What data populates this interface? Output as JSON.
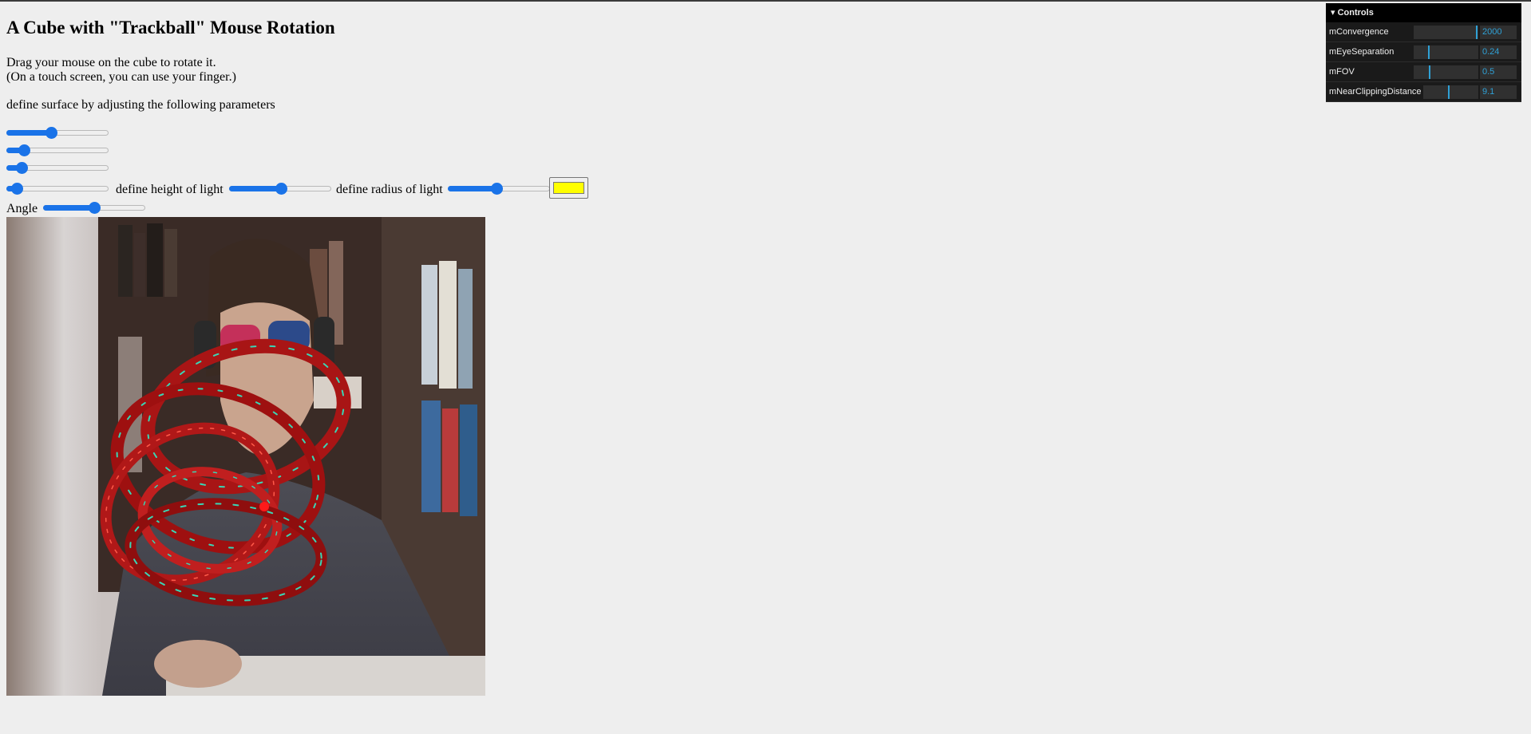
{
  "page": {
    "title": "A Cube with \"Trackball\" Mouse Rotation",
    "instructions_line1": "Drag your mouse on the cube to rotate it.",
    "instructions_line2": "(On a touch screen, you can use your finger.)",
    "surface_prompt": "define surface by adjusting the following parameters"
  },
  "sliders": {
    "surface_param_1": 0.44,
    "surface_param_2": 0.17,
    "surface_param_3": 0.15,
    "surface_param_4": 0.1,
    "light_height_label": "define height of light",
    "light_height": 0.51,
    "light_radius_label": "define radius of light",
    "light_radius": 0.48,
    "angle_label": "Angle",
    "angle": 0.5
  },
  "light_color": "#ffff00",
  "controls": {
    "title": "Controls",
    "items": [
      {
        "name": "mConvergence",
        "value": "2000",
        "fraction": 0.97
      },
      {
        "name": "mEyeSeparation",
        "value": "0.24",
        "fraction": 0.24
      },
      {
        "name": "mFOV",
        "value": "0.5",
        "fraction": 0.25
      },
      {
        "name": "mNearClippingDistance",
        "value": "9.1",
        "fraction": 0.46
      }
    ]
  },
  "icons": {
    "collapse": "chevron-down-icon"
  }
}
